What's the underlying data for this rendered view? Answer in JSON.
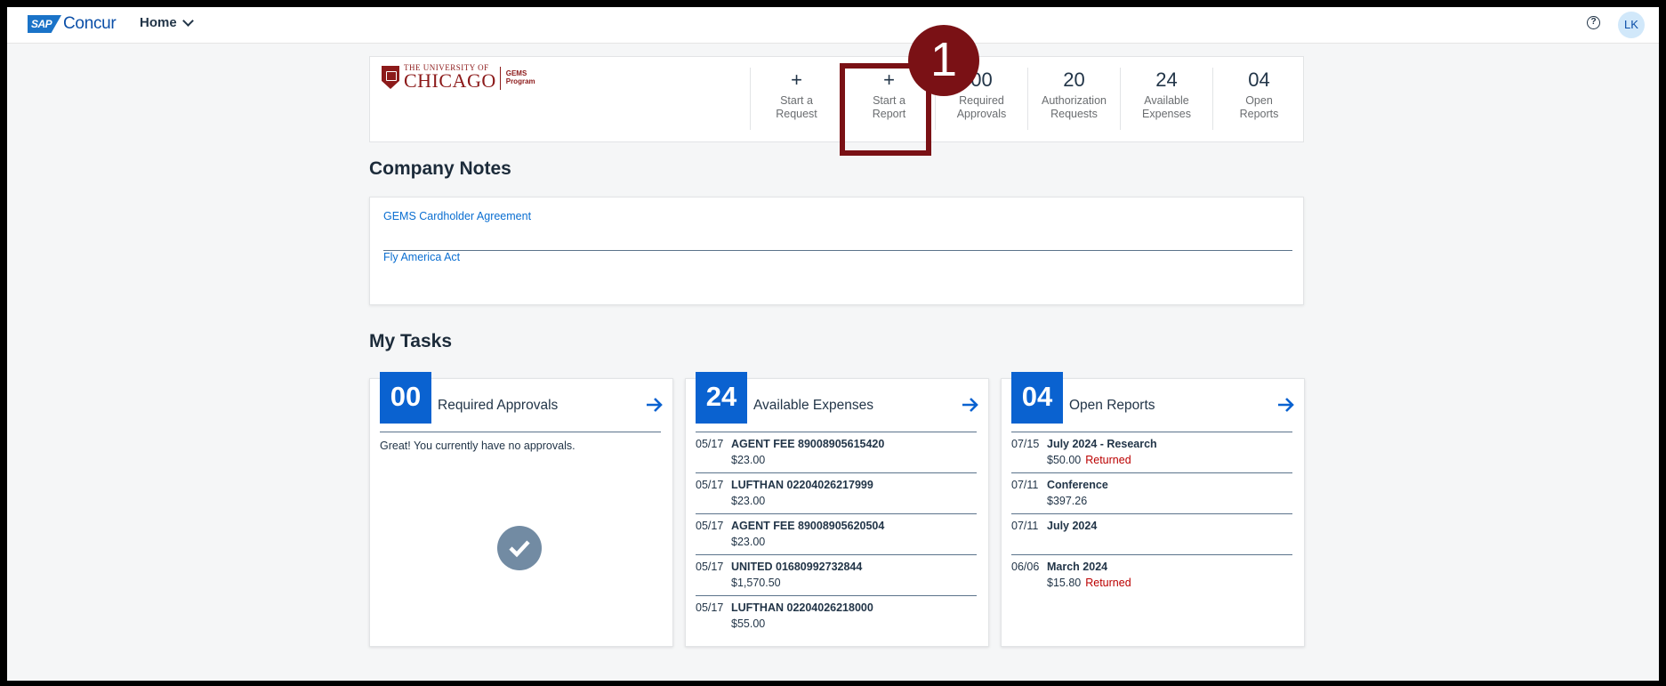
{
  "topbar": {
    "brand_sap": "SAP",
    "brand_name": "Concur",
    "home_label": "Home",
    "help_icon": "question-circle-icon",
    "avatar_initials": "LK"
  },
  "org": {
    "line1": "THE UNIVERSITY OF",
    "line2": "CHICAGO",
    "program_line1": "GEMS",
    "program_line2": "Program"
  },
  "quick_actions": [
    {
      "top": "+",
      "label_line1": "Start a",
      "label_line2": "Request"
    },
    {
      "top": "+",
      "label_line1": "Start a",
      "label_line2": "Report"
    },
    {
      "top": "00",
      "label_line1": "Required",
      "label_line2": "Approvals"
    },
    {
      "top": "20",
      "label_line1": "Authorization",
      "label_line2": "Requests"
    },
    {
      "top": "24",
      "label_line1": "Available",
      "label_line2": "Expenses"
    },
    {
      "top": "04",
      "label_line1": "Open",
      "label_line2": "Reports"
    }
  ],
  "annotation": {
    "step_number": "1",
    "color": "#7a1115"
  },
  "company_notes": {
    "title": "Company Notes",
    "links": [
      "GEMS Cardholder Agreement",
      "Fly America Act"
    ]
  },
  "my_tasks": {
    "title": "My Tasks",
    "approvals": {
      "count": "00",
      "title": "Required Approvals",
      "empty_text": "Great! You currently have no approvals."
    },
    "expenses": {
      "count": "24",
      "title": "Available Expenses",
      "items": [
        {
          "date": "05/17",
          "name": "AGENT FEE 89008905615420",
          "amount": "$23.00"
        },
        {
          "date": "05/17",
          "name": "LUFTHAN 02204026217999",
          "amount": "$23.00"
        },
        {
          "date": "05/17",
          "name": "AGENT FEE 89008905620504",
          "amount": "$23.00"
        },
        {
          "date": "05/17",
          "name": "UNITED 01680992732844",
          "amount": "$1,570.50"
        },
        {
          "date": "05/17",
          "name": "LUFTHAN 02204026218000",
          "amount": "$55.00"
        }
      ]
    },
    "reports": {
      "count": "04",
      "title": "Open Reports",
      "items": [
        {
          "date": "07/15",
          "name": "July 2024 - Research",
          "amount": "$50.00",
          "status": "Returned"
        },
        {
          "date": "07/11",
          "name": "Conference",
          "amount": "$397.26",
          "status": ""
        },
        {
          "date": "07/11",
          "name": "July 2024",
          "amount": "",
          "status": ""
        },
        {
          "date": "06/06",
          "name": "March 2024",
          "amount": "$15.80",
          "status": "Returned"
        }
      ]
    }
  },
  "colors": {
    "accent": "#0a62d0",
    "brand_maroon": "#8c1a1a",
    "status_returned": "#bb0000"
  }
}
